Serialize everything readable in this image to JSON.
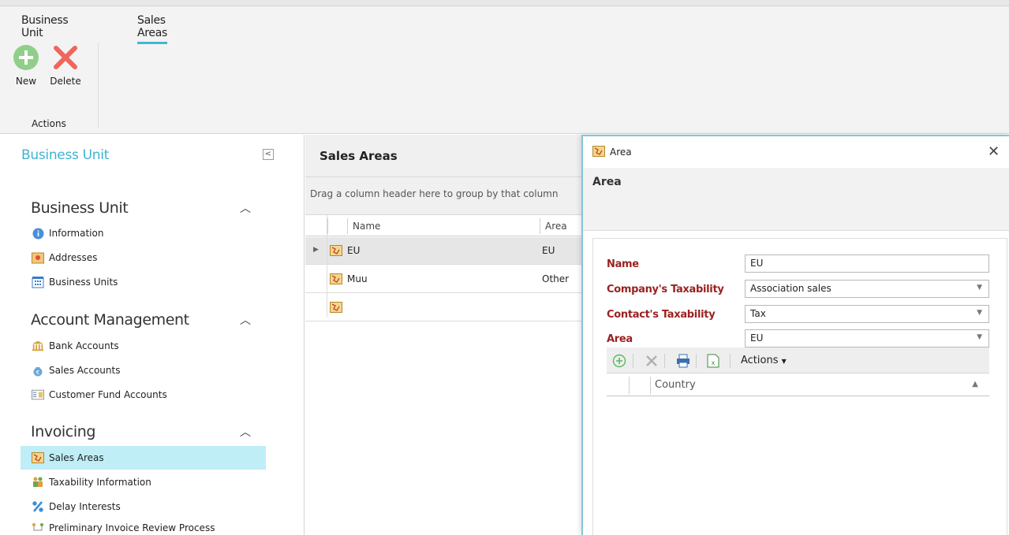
{
  "ribbon": {
    "tabs": [
      {
        "label": "Business Unit",
        "active": false
      },
      {
        "label": "Sales Areas",
        "active": true
      }
    ],
    "new_label": "New",
    "delete_label": "Delete",
    "group_label": "Actions"
  },
  "nav": {
    "title": "Business Unit",
    "sections": [
      {
        "title": "Business Unit",
        "items": [
          "Information",
          "Addresses",
          "Business Units"
        ]
      },
      {
        "title": "Account Management",
        "items": [
          "Bank Accounts",
          "Sales Accounts",
          "Customer Fund Accounts"
        ]
      },
      {
        "title": "Invoicing",
        "items": [
          "Sales Areas",
          "Taxability Information",
          "Delay Interests",
          "Preliminary Invoice Review Process"
        ]
      }
    ],
    "selected": "Sales Areas"
  },
  "grid": {
    "title": "Sales Areas",
    "group_hint": "Drag a column header here to group by that column",
    "columns": [
      "Name",
      "Area"
    ],
    "rows": [
      {
        "name": "EU",
        "area": "EU"
      },
      {
        "name": "Muu",
        "area": "Other"
      },
      {
        "name": "",
        "area": ""
      }
    ]
  },
  "dialog": {
    "title": "Area",
    "header": "Area",
    "fields": {
      "name_label": "Name",
      "name_value": "EU",
      "company_tax_label": "Company's Taxability",
      "company_tax_value": "Association sales",
      "contact_tax_label": "Contact's Taxability",
      "contact_tax_value": "Tax",
      "area_label": "Area",
      "area_value": "EU"
    },
    "actions_label": "Actions",
    "country_column": "Country"
  },
  "colors": {
    "accent": "#3fb8d2",
    "selected_nav": "#bfeef7",
    "required_label": "#9b2121"
  }
}
